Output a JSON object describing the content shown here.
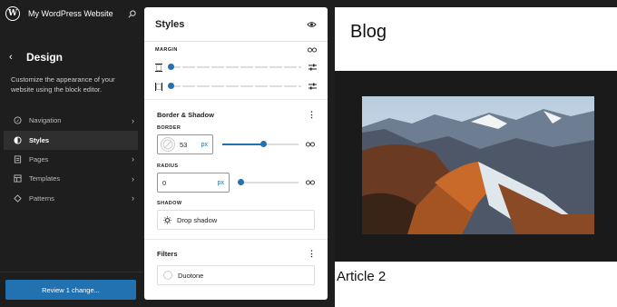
{
  "site": {
    "title": "My WordPress Website"
  },
  "design": {
    "title": "Design",
    "description": "Customize the appearance of your website using the block editor."
  },
  "nav": [
    {
      "label": "Navigation",
      "icon": "navigation-icon",
      "active": false
    },
    {
      "label": "Styles",
      "icon": "half-circle-icon",
      "active": true
    },
    {
      "label": "Pages",
      "icon": "page-icon",
      "active": false
    },
    {
      "label": "Templates",
      "icon": "layout-icon",
      "active": false
    },
    {
      "label": "Patterns",
      "icon": "symbol-icon",
      "active": false
    }
  ],
  "review_button": "Review 1 change...",
  "panel": {
    "title": "Styles",
    "margin_label": "MARGIN",
    "margin_values": [
      0,
      0
    ],
    "border_shadow": {
      "title": "Border & Shadow",
      "border_label": "BORDER",
      "border_value": "53",
      "border_unit": "px",
      "border_slider_fraction": 0.53,
      "radius_label": "RADIUS",
      "radius_value": "0",
      "radius_unit": "px",
      "radius_slider_fraction": 0,
      "shadow_label": "SHADOW",
      "shadow_value": "Drop shadow"
    },
    "filters": {
      "title": "Filters",
      "duotone_label": "Duotone"
    }
  },
  "preview": {
    "blog_title": "Blog",
    "article_title": "Article 2"
  },
  "colors": {
    "accent": "#2271b1",
    "sidebar_bg": "#1e1e1e"
  }
}
